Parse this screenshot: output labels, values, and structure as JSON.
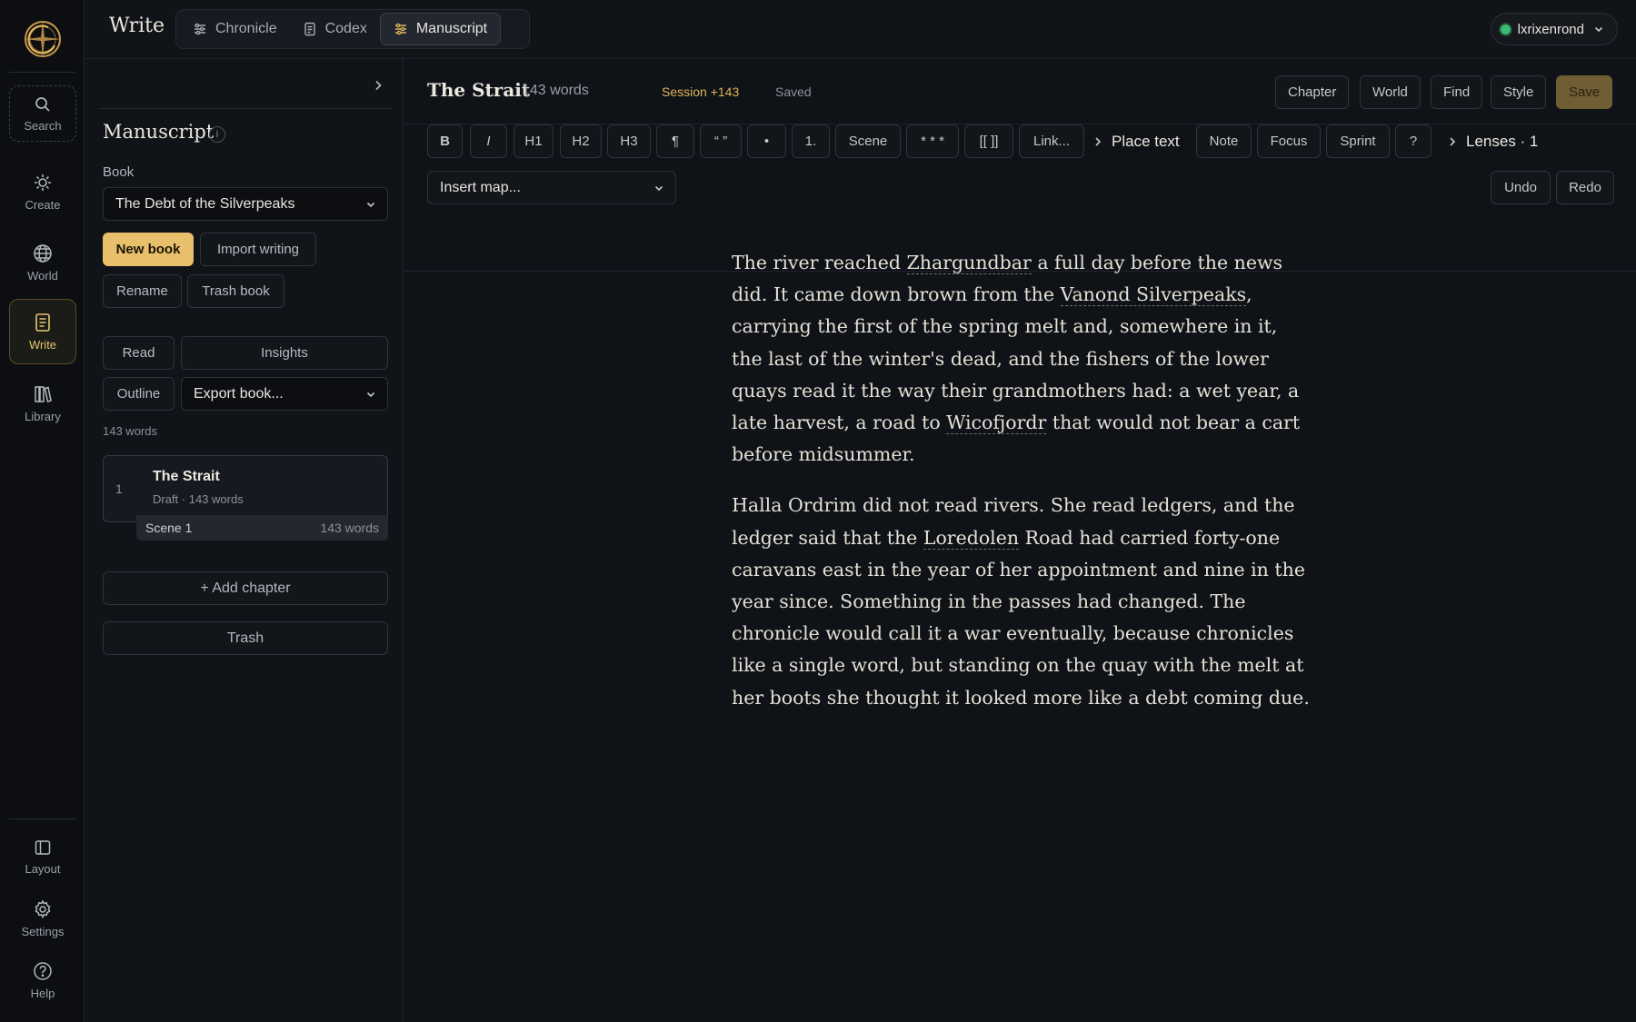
{
  "app": {
    "title": "Write"
  },
  "modes": [
    {
      "label": "Chronicle",
      "icon": "sliders-icon"
    },
    {
      "label": "Codex",
      "icon": "document-icon"
    },
    {
      "label": "Manuscript",
      "icon": "sliders-icon",
      "active": true
    }
  ],
  "user": {
    "name": "lxrixenrond",
    "status": "online",
    "status_color": "#3dba6f"
  },
  "rail": {
    "top": [
      {
        "label": "Search",
        "icon": "search-icon"
      },
      {
        "label": "Create",
        "icon": "sun-icon"
      },
      {
        "label": "World",
        "icon": "globe-icon"
      },
      {
        "label": "Write",
        "icon": "notebook-icon",
        "active": true
      },
      {
        "label": "Library",
        "icon": "books-icon"
      }
    ],
    "bottom": [
      {
        "label": "Layout",
        "icon": "layout-icon"
      },
      {
        "label": "Settings",
        "icon": "gear-icon"
      },
      {
        "label": "Help",
        "icon": "help-icon"
      }
    ]
  },
  "panel": {
    "title": "Manuscript",
    "info": "i",
    "book_label": "Book",
    "book_selected": "The Debt of the Silverpeaks",
    "buttons": {
      "new_book": "New book",
      "import_writing": "Import writing",
      "rename": "Rename",
      "trash_book": "Trash book",
      "read": "Read",
      "insights": "Insights",
      "outline": "Outline",
      "add_chapter": "+ Add chapter",
      "trash": "Trash"
    },
    "export_selected": "Export book...",
    "word_total": "143 words",
    "chapters": [
      {
        "number": "1",
        "title": "The Strait",
        "meta": "Draft · 143 words",
        "scenes": [
          {
            "label": "Scene 1",
            "words": "143 words"
          }
        ]
      }
    ]
  },
  "document": {
    "title": "The Strait",
    "words": "143 words",
    "session": "Session +143",
    "save_state": "Saved",
    "header_buttons": {
      "chapter": "Chapter",
      "world": "World",
      "find": "Find",
      "style": "Style",
      "save": "Save"
    },
    "toolbar": {
      "bold": "B",
      "italic": "I",
      "h1": "H1",
      "h2": "H2",
      "h3": "H3",
      "para": "¶",
      "quote": "“ ”",
      "bullet": "•",
      "numbered": "1.",
      "scene": "Scene",
      "break": "* * *",
      "wikilink": "[[ ]]",
      "link": "Link...",
      "place_text": "Place text",
      "note": "Note",
      "focus": "Focus",
      "sprint": "Sprint",
      "help": "?",
      "lenses": "Lenses · 1",
      "insert_map": "Insert map...",
      "undo": "Undo",
      "redo": "Redo"
    },
    "paragraphs": [
      [
        {
          "t": "The river reached "
        },
        {
          "t": "Zhargundbar",
          "entity": true
        },
        {
          "t": " a full day before the news did. It came down brown from the "
        },
        {
          "t": "Vanond Silverpeaks",
          "entity": true
        },
        {
          "t": ", carrying the first of the spring melt and, somewhere in it, the last of the winter's dead, and the fishers of the lower quays read it the way their grandmothers had: a wet year, a late harvest, a road to "
        },
        {
          "t": "Wicofjordr",
          "entity": true
        },
        {
          "t": " that would not bear a cart before midsummer."
        }
      ],
      [
        {
          "t": "Halla Ordrim did not read rivers. She read ledgers, and the ledger said that the "
        },
        {
          "t": "Loredolen",
          "entity": true
        },
        {
          "t": " Road had carried forty-one caravans east in the year of her appointment and nine in the year since. Something in the passes had changed. The chronicle would call it a war eventually, because chronicles like a single word, but standing on the quay with the melt at her boots she thought it looked more like a debt coming due."
        }
      ]
    ]
  },
  "colors": {
    "accent": "#e8bf6a",
    "session": "#e0b55a",
    "active_rail": "#e6c66e"
  }
}
